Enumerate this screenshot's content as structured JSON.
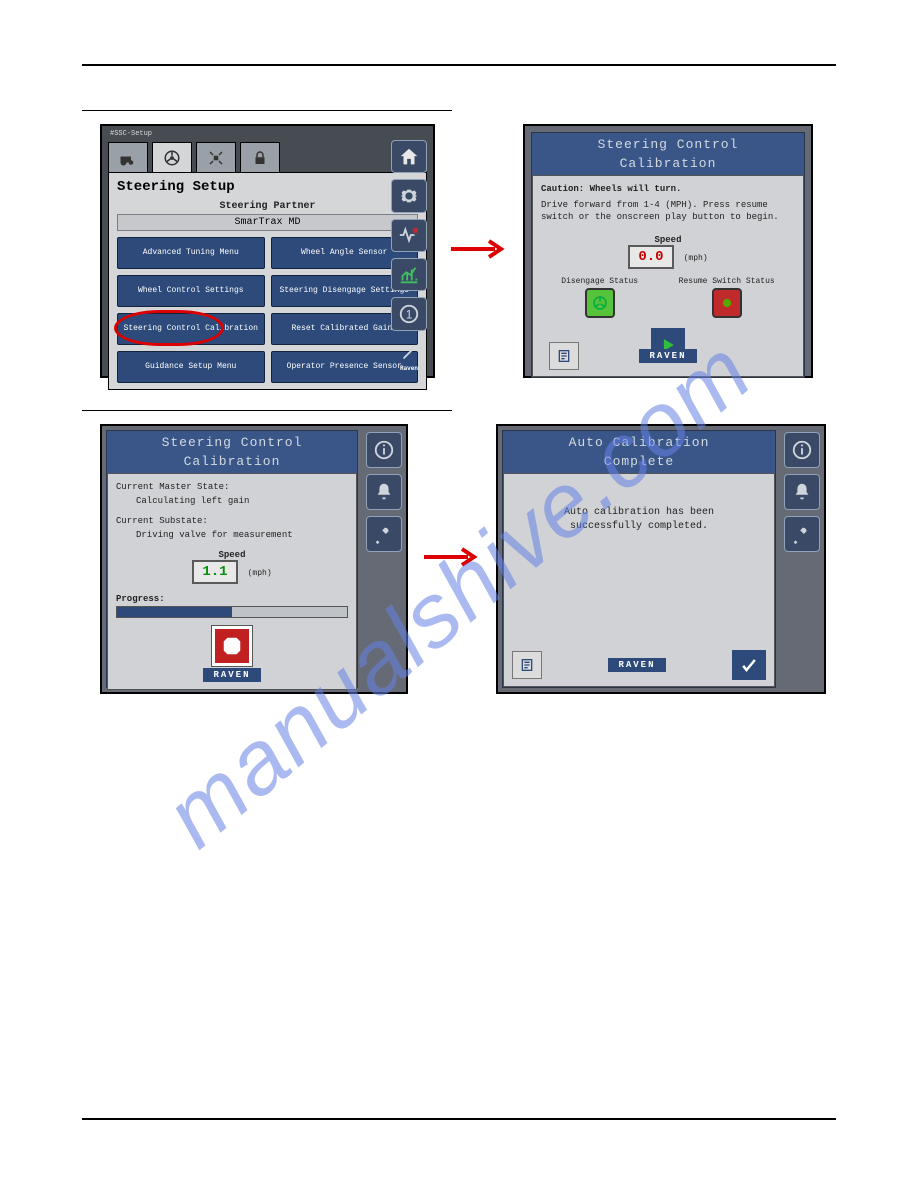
{
  "watermark": "manualshive.com",
  "row1": {
    "panel1": {
      "asc": "#SSC-Setup",
      "title": "Steering Setup",
      "partner_label": "Steering Partner",
      "partner_value": "SmarTrax MD",
      "buttons": [
        "Advanced Tuning Menu",
        "Wheel Angle Sensor",
        "Wheel Control Settings",
        "Steering Disengage Settings",
        "Steering Control Calibration",
        "Reset Calibrated Gains",
        "Guidance Setup Menu",
        "Operator Presence Sensor"
      ],
      "raven": "Raven"
    },
    "panel2": {
      "title1": "Steering Control",
      "title2": "Calibration",
      "caution": "Caution: Wheels will turn.",
      "instr": "Drive forward from 1-4 (MPH). Press resume switch or the onscreen play button to begin.",
      "speed_label": "Speed",
      "speed_value": "0.0",
      "speed_unit": "(mph)",
      "disengage": "Disengage Status",
      "resume": "Resume Switch Status",
      "raven": "RAVEN"
    }
  },
  "row2": {
    "panel3": {
      "title1": "Steering Control",
      "title2": "Calibration",
      "master_label": "Current Master State:",
      "master_value": "Calculating left gain",
      "sub_label": "Current Substate:",
      "sub_value": "Driving valve for measurement",
      "speed_label": "Speed",
      "speed_value": "1.1",
      "speed_unit": "(mph)",
      "progress_label": "Progress:",
      "progress_pct": 50,
      "raven": "RAVEN"
    },
    "panel4": {
      "title1": "Auto Calibration",
      "title2": "Complete",
      "msg1": "Auto calibration has been",
      "msg2": "successfully completed.",
      "raven": "RAVEN"
    }
  }
}
